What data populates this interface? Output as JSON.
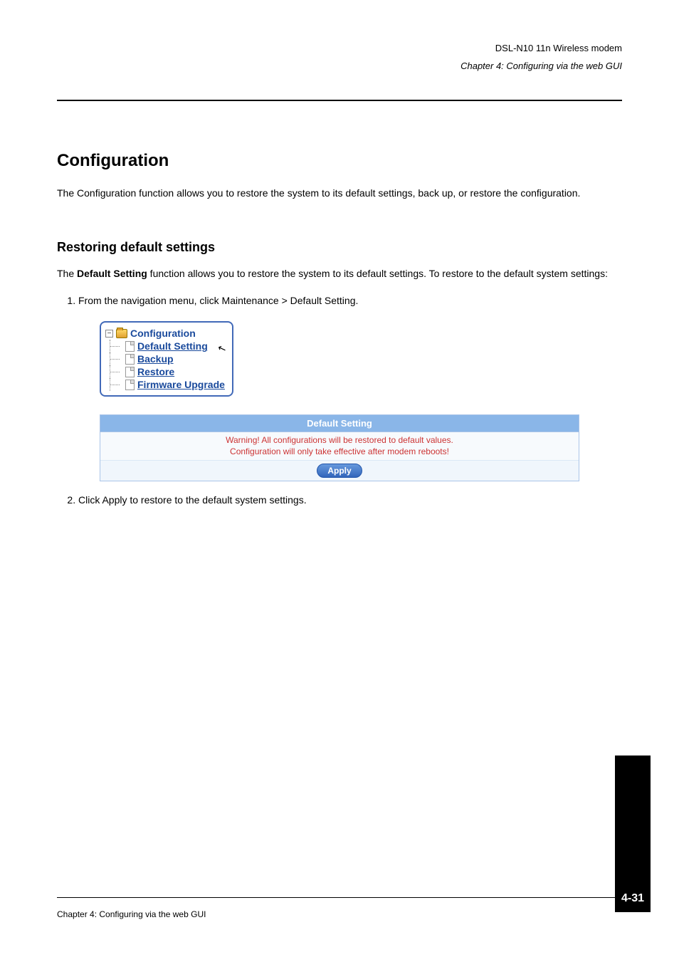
{
  "header": {
    "product": "DSL-N10 11n Wireless modem",
    "chapter": "Chapter 4: Configuring via the web GUI"
  },
  "section": {
    "title": "Configuration",
    "body": "The Configuration function allows you to restore the system to its default settings, back up, or restore the configuration."
  },
  "restore": {
    "title": "Restoring default settings",
    "body_prefix": "The ",
    "body_bold": "Default Setting",
    "body_suffix": " function allows you to restore the system to its default settings. To restore to the default system settings:",
    "step1": "From the navigation menu, click Maintenance > Default Setting.",
    "step2": "Click Apply to restore to the default system settings."
  },
  "tree": {
    "root": "Configuration",
    "items": [
      "Default Setting",
      "Backup",
      "Restore"
    ],
    "sibling": "Firmware Upgrade"
  },
  "panel": {
    "title": "Default Setting",
    "warn1": "Warning! All configurations will be restored to default values.",
    "warn2": "Configuration will only take effective after modem reboots!",
    "apply": "Apply"
  },
  "footer": {
    "page": "4-31",
    "chapter": "Chapter 4: Configuring via the web GUI"
  }
}
